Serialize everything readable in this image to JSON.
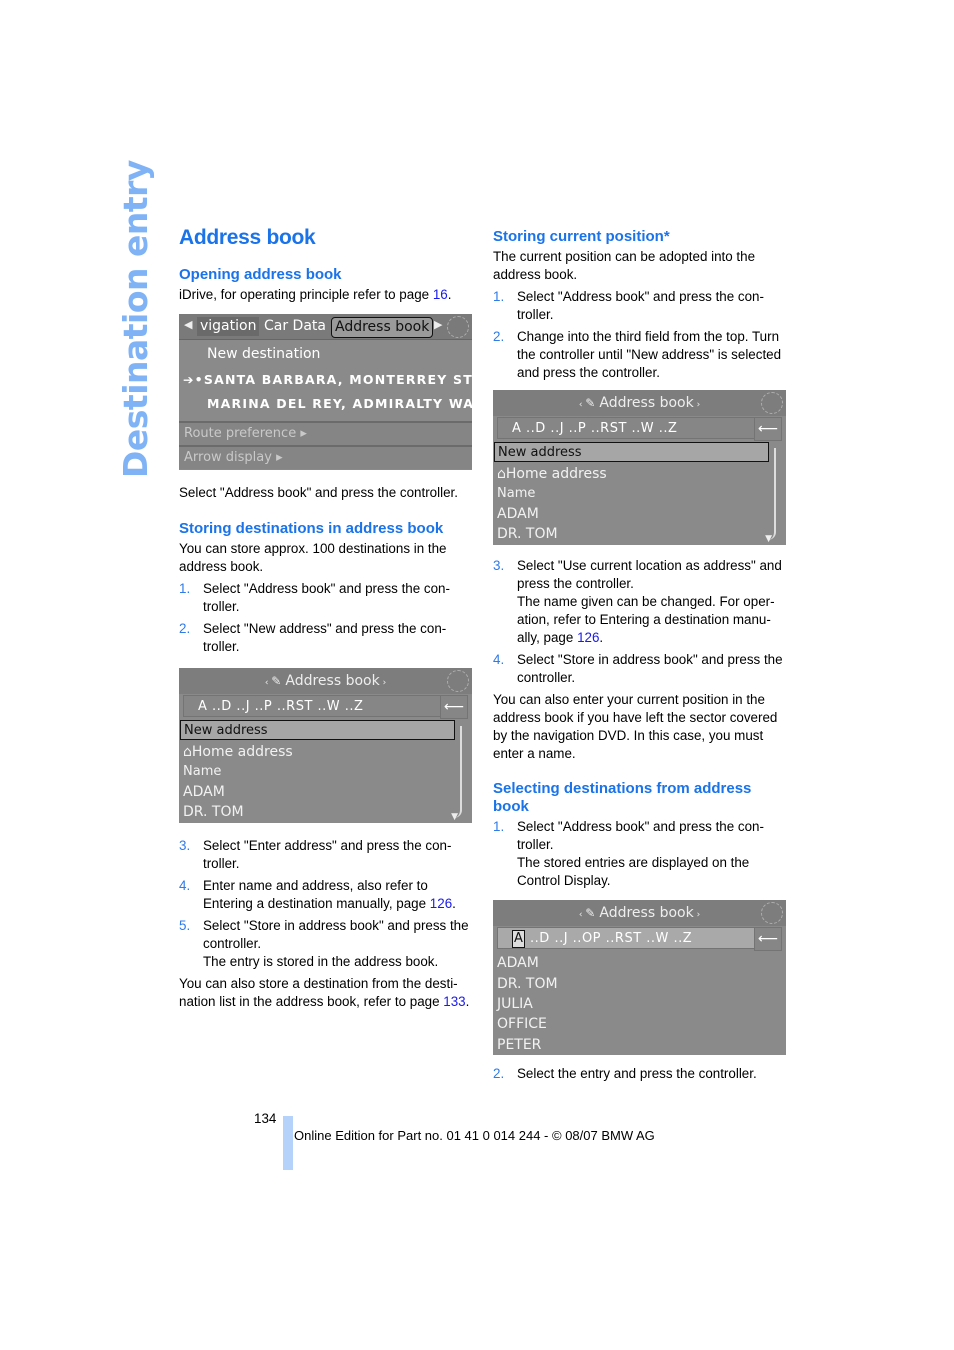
{
  "side_title": "Destination entry",
  "left": {
    "title": "Address book",
    "opening": {
      "heading": "Opening address book",
      "text": "iDrive, for operating principle refer to page ",
      "page_link": "16",
      "text_end": "."
    },
    "screen1": {
      "tabs": [
        "vigation",
        "Car Data",
        "Address book"
      ],
      "active_tab": "Address book",
      "items": [
        "New destination",
        "SANTA BARBARA, MONTERREY ST",
        "MARINA DEL REY, ADMIRALTY WA"
      ],
      "item_marker": "➔•",
      "subitems": [
        "Route preference ▸",
        "Arrow display ▸"
      ]
    },
    "caption": "Select \"Address book\" and press the controller.",
    "storing": {
      "heading": "Storing destinations in address book",
      "intro": "You can store approx. 100 destinations in the address book.",
      "steps_a": [
        {
          "num": "1.",
          "text": "Select \"Address book\" and press the con-troller."
        },
        {
          "num": "2.",
          "text": "Select \"New address\" and press the con-troller."
        }
      ],
      "steps_b": [
        {
          "num": "3.",
          "text": "Select \"Enter address\" and press the con-troller."
        },
        {
          "num": "4.",
          "text": "Enter name and address, also refer to Entering a destination manually, page ",
          "link": "126",
          "end": "."
        },
        {
          "num": "5.",
          "text": "Select \"Store in address book\" and press the controller.",
          "note": "The entry is stored in the address book."
        }
      ],
      "outro": "You can also store a destination from the desti-nation list in the address book, refer to page ",
      "outro_link": "133",
      "outro_end": "."
    },
    "screen2": {
      "header": "Address book",
      "alphabet": "A ..D ..J ..P ..RST ..W ..Z",
      "back": "⟵",
      "selected": "New address",
      "rows": [
        "⌂Home address",
        "Name",
        "ADAM",
        "DR. TOM"
      ]
    }
  },
  "right": {
    "current": {
      "heading": "Storing current position*",
      "intro": "The current position can be adopted into the address book.",
      "steps_a": [
        {
          "num": "1.",
          "text": "Select \"Address book\" and press the con-troller."
        },
        {
          "num": "2.",
          "text": "Change into the third field from the top. Turn the controller until \"New address\" is selected and press the controller."
        }
      ],
      "steps_b": [
        {
          "num": "3.",
          "text": "Select \"Use current location as address\" and press the controller.",
          "note": "The name given can be changed. For oper-ation, refer to Entering a destination manu-ally, page ",
          "link": "126",
          "end": "."
        },
        {
          "num": "4.",
          "text": "Select \"Store in address book\" and press the controller."
        }
      ],
      "outro": "You can also enter your current position in the address book if you have left the sector covered by the navigation DVD. In this case, you must enter a name."
    },
    "screen3": {
      "header": "Address book",
      "alphabet": "A ..D ..J ..P ..RST ..W ..Z",
      "back": "⟵",
      "selected": "New address",
      "rows": [
        "⌂Home address",
        "Name",
        "ADAM",
        "DR. TOM"
      ]
    },
    "selecting": {
      "heading": "Selecting destinations from address book",
      "step1": {
        "num": "1.",
        "text": "Select \"Address book\" and press the con-troller.",
        "note": "The stored entries are displayed on the Control Display."
      },
      "step2": {
        "num": "2.",
        "text": "Select the entry and press the controller."
      }
    },
    "screen4": {
      "header": "Address book",
      "cursor": "A",
      "alphabet_rest": " ..D ..J ..OP ..RST ..W ..Z",
      "back": "⟵",
      "rows": [
        "ADAM",
        "DR. TOM",
        "JULIA",
        "OFFICE",
        "PETER"
      ]
    }
  },
  "footer": {
    "page_number": "134",
    "text": "Online Edition for Part no. 01 41 0 014 244 - © 08/07 BMW AG"
  }
}
